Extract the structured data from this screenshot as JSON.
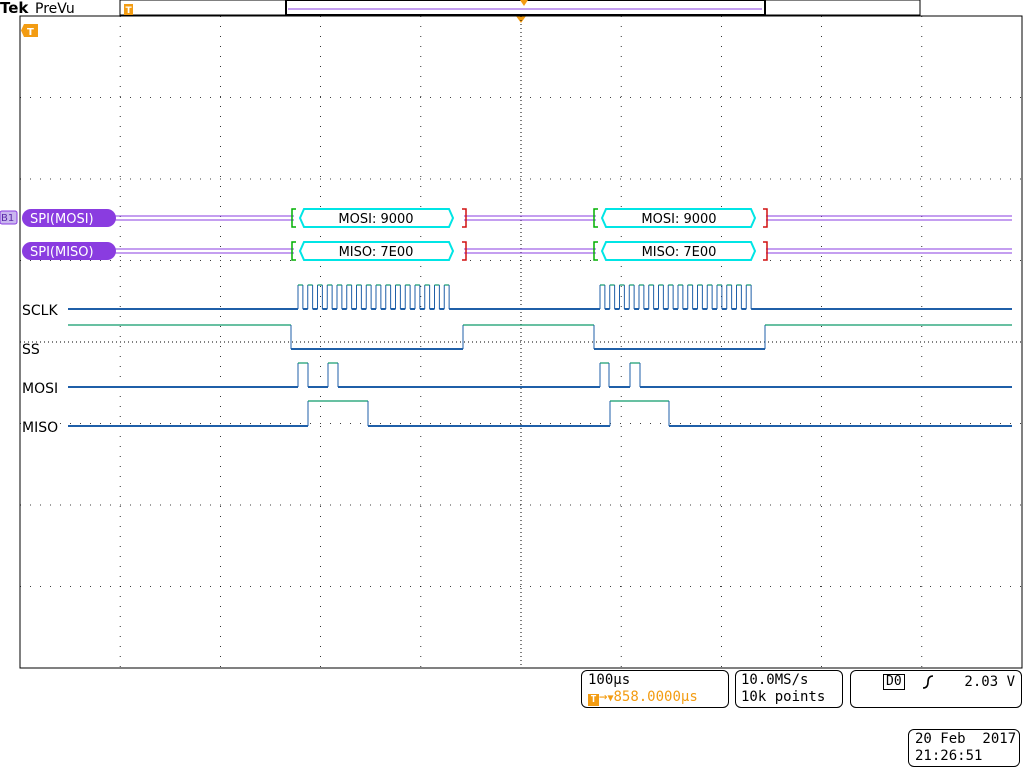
{
  "header": {
    "brand": "Tek",
    "mode": "PreVu"
  },
  "colors": {
    "grid": "#000000",
    "bus_badge": "#8a3ce0",
    "bus_line": "#8a3ce0",
    "decode_box": "#00e5e5",
    "bracket_start": "#00b000",
    "bracket_end": "#d01010",
    "digital_low": "#1f5fa8",
    "digital_high": "#0f9a6a",
    "trigger": "#f39c12"
  },
  "buses": [
    {
      "label": "SPI(MOSI)",
      "frames": [
        {
          "text": "MOSI: 9000"
        },
        {
          "text": "MOSI: 9000"
        }
      ]
    },
    {
      "label": "SPI(MISO)",
      "frames": [
        {
          "text": "MISO: 7E00"
        },
        {
          "text": "MISO: 7E00"
        }
      ]
    }
  ],
  "bus_marker": "B1",
  "trigger_marker": "T",
  "channels": [
    {
      "label": "SCLK"
    },
    {
      "label": "SS"
    },
    {
      "label": "MOSI"
    },
    {
      "label": "MISO"
    }
  ],
  "status": {
    "timebase": "100µs",
    "trigger_position": "858.0000µs",
    "trigger_prefix": "T",
    "sample_rate": "10.0MS/s",
    "record_length": "10k points",
    "trigger_source": "D0",
    "trigger_slope": "rising",
    "trigger_level": "2.03 V"
  },
  "datetime": {
    "date": "20 Feb  2017",
    "time": "21:26:51"
  }
}
